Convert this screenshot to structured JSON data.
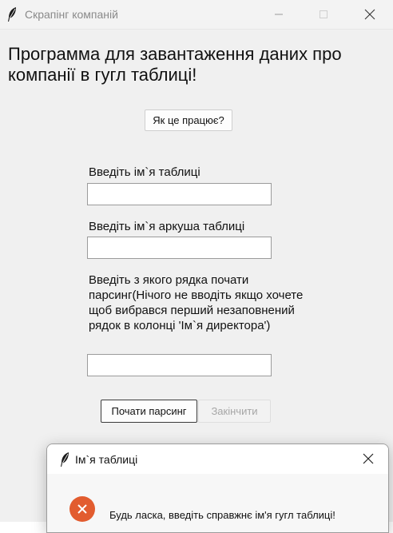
{
  "window": {
    "title": "Скрапінг компаній"
  },
  "main": {
    "heading": "Программа для завантаження даних про компанії в гугл таблиці!",
    "how_button": "Як це працює?",
    "fields": [
      {
        "label": "Введіть ім`я таблиці",
        "value": ""
      },
      {
        "label": "Введіть ім`я аркуша таблиці",
        "value": ""
      },
      {
        "label": "Введіть з якого рядка почати парсинг(Нічого не вводіть якщо хочете щоб вибрався перший незаповнений рядок в колонці 'Ім`я директора')",
        "value": ""
      }
    ],
    "start_button": "Почати парсинг",
    "finish_button": "Закінчити"
  },
  "dialog": {
    "title": "Ім`я таблиці",
    "message": "Будь ласка, введіть справжнє ім'я гугл таблиці!"
  },
  "colors": {
    "window_bg": "#f0f0f0",
    "error_icon": "#e25c2f",
    "disabled_text": "#a6a6a6"
  },
  "icons": {
    "app": "feather-icon",
    "minimize": "minimize-icon",
    "maximize": "maximize-icon",
    "close": "close-icon",
    "error": "error-icon"
  }
}
